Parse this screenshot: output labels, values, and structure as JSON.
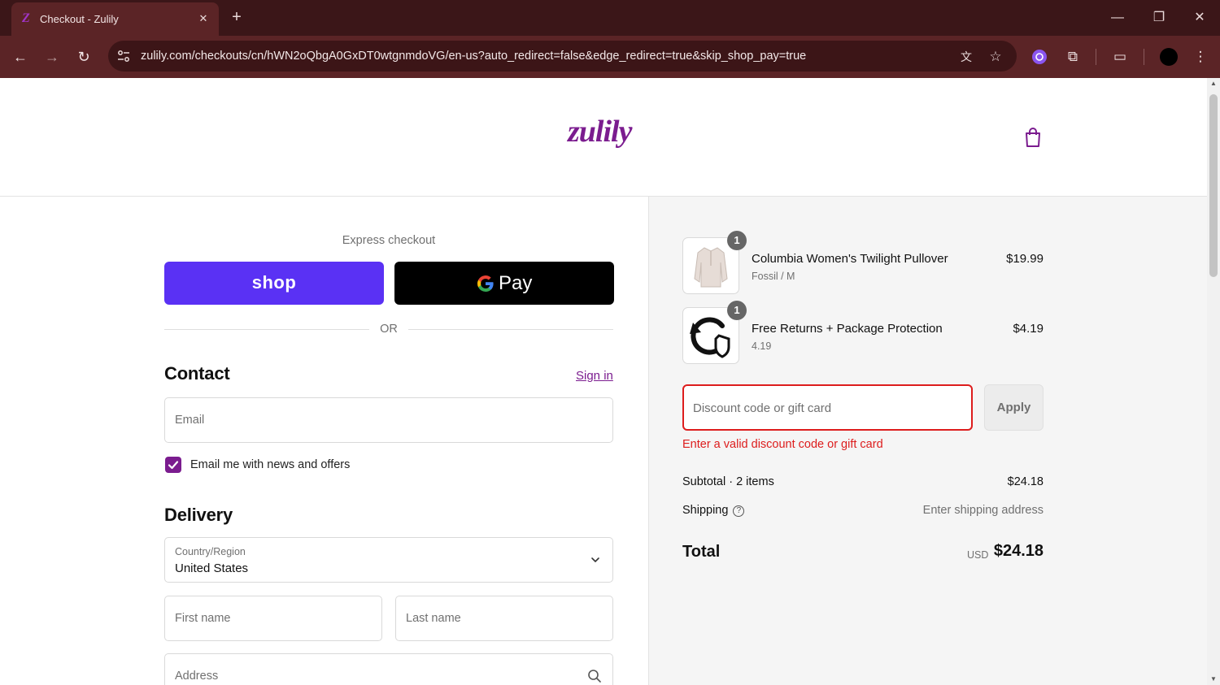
{
  "browser": {
    "tab_title": "Checkout - Zulily",
    "favicon_letter": "Z",
    "url": "zulily.com/checkouts/cn/hWN2oQbgA0GxDT0wtgnmdoVG/en-us?auto_redirect=false&edge_redirect=true&skip_shop_pay=true"
  },
  "header": {
    "logo_text": "zulily",
    "brand_color": "#7b1c8f"
  },
  "checkout": {
    "express_label": "Express checkout",
    "shop_pay_label": "shop",
    "gpay_label": "Pay",
    "or_label": "OR",
    "contact": {
      "title": "Contact",
      "signin_label": "Sign in",
      "email_placeholder": "Email",
      "newsletter_label": "Email me with news and offers",
      "newsletter_checked": true
    },
    "delivery": {
      "title": "Delivery",
      "country_label": "Country/Region",
      "country_value": "United States",
      "first_name_placeholder": "First name",
      "last_name_placeholder": "Last name",
      "address_placeholder": "Address"
    }
  },
  "summary": {
    "items": [
      {
        "name": "Columbia Women's Twilight Pullover",
        "variant": "Fossil / M",
        "price": "$19.99",
        "qty": "1"
      },
      {
        "name": "Free Returns + Package Protection",
        "variant": "4.19",
        "price": "$4.19",
        "qty": "1"
      }
    ],
    "discount_placeholder": "Discount code or gift card",
    "apply_label": "Apply",
    "discount_error": "Enter a valid discount code or gift card",
    "subtotal_label": "Subtotal · 2 items",
    "subtotal_value": "$24.18",
    "shipping_label": "Shipping",
    "shipping_value": "Enter shipping address",
    "total_label": "Total",
    "total_currency": "USD",
    "total_value": "$24.18",
    "error_color": "#dd1d1d"
  }
}
